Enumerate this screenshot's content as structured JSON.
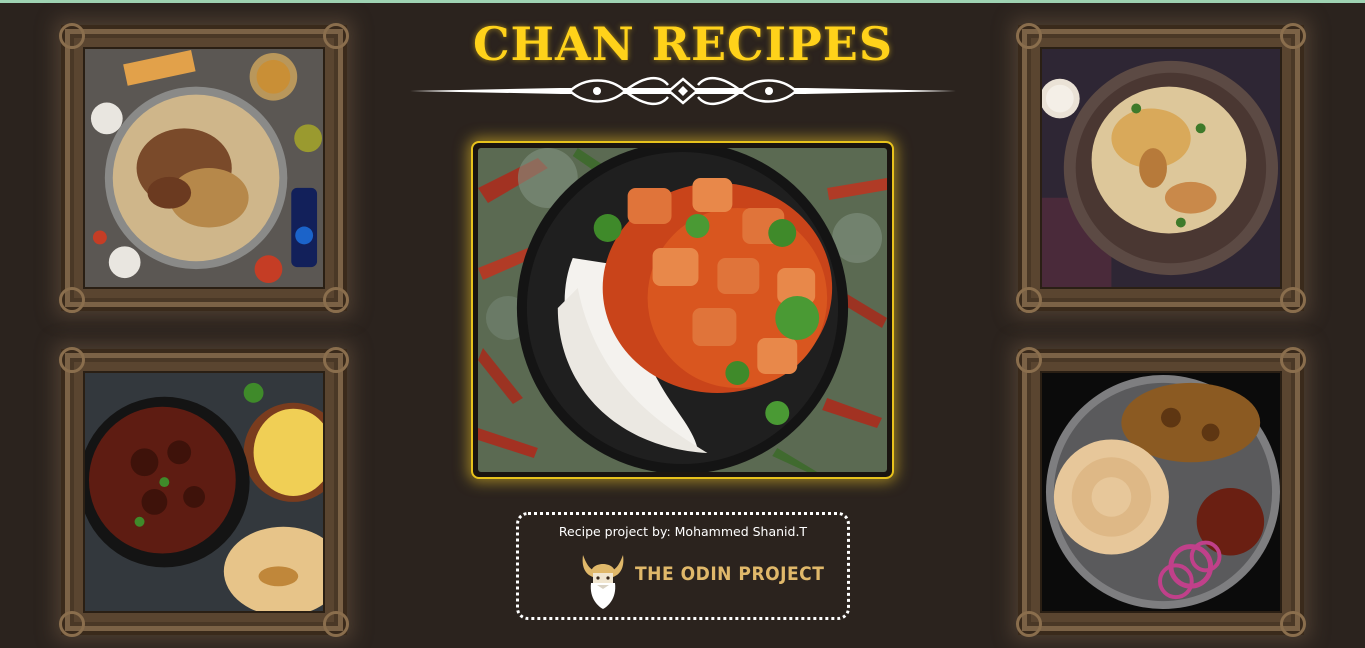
{
  "header": {
    "title": "CHAN RECIPES"
  },
  "gallery": {
    "top_left": {
      "dish": "mandi"
    },
    "top_right": {
      "dish": "biryani"
    },
    "bottom_left": {
      "dish": "beef-curry"
    },
    "bottom_right": {
      "dish": "parotta"
    },
    "center": {
      "dish": "chicken-curry-rice"
    }
  },
  "footer": {
    "credit": "Recipe project by: Mohammed Shanid.T",
    "brand": "THE ODIN PROJECT"
  },
  "colors": {
    "background": "#2b231e",
    "title": "#ffd21a",
    "hero_border": "#e8c21c",
    "brand": "#e0b86a",
    "frame": "#5a4530"
  }
}
